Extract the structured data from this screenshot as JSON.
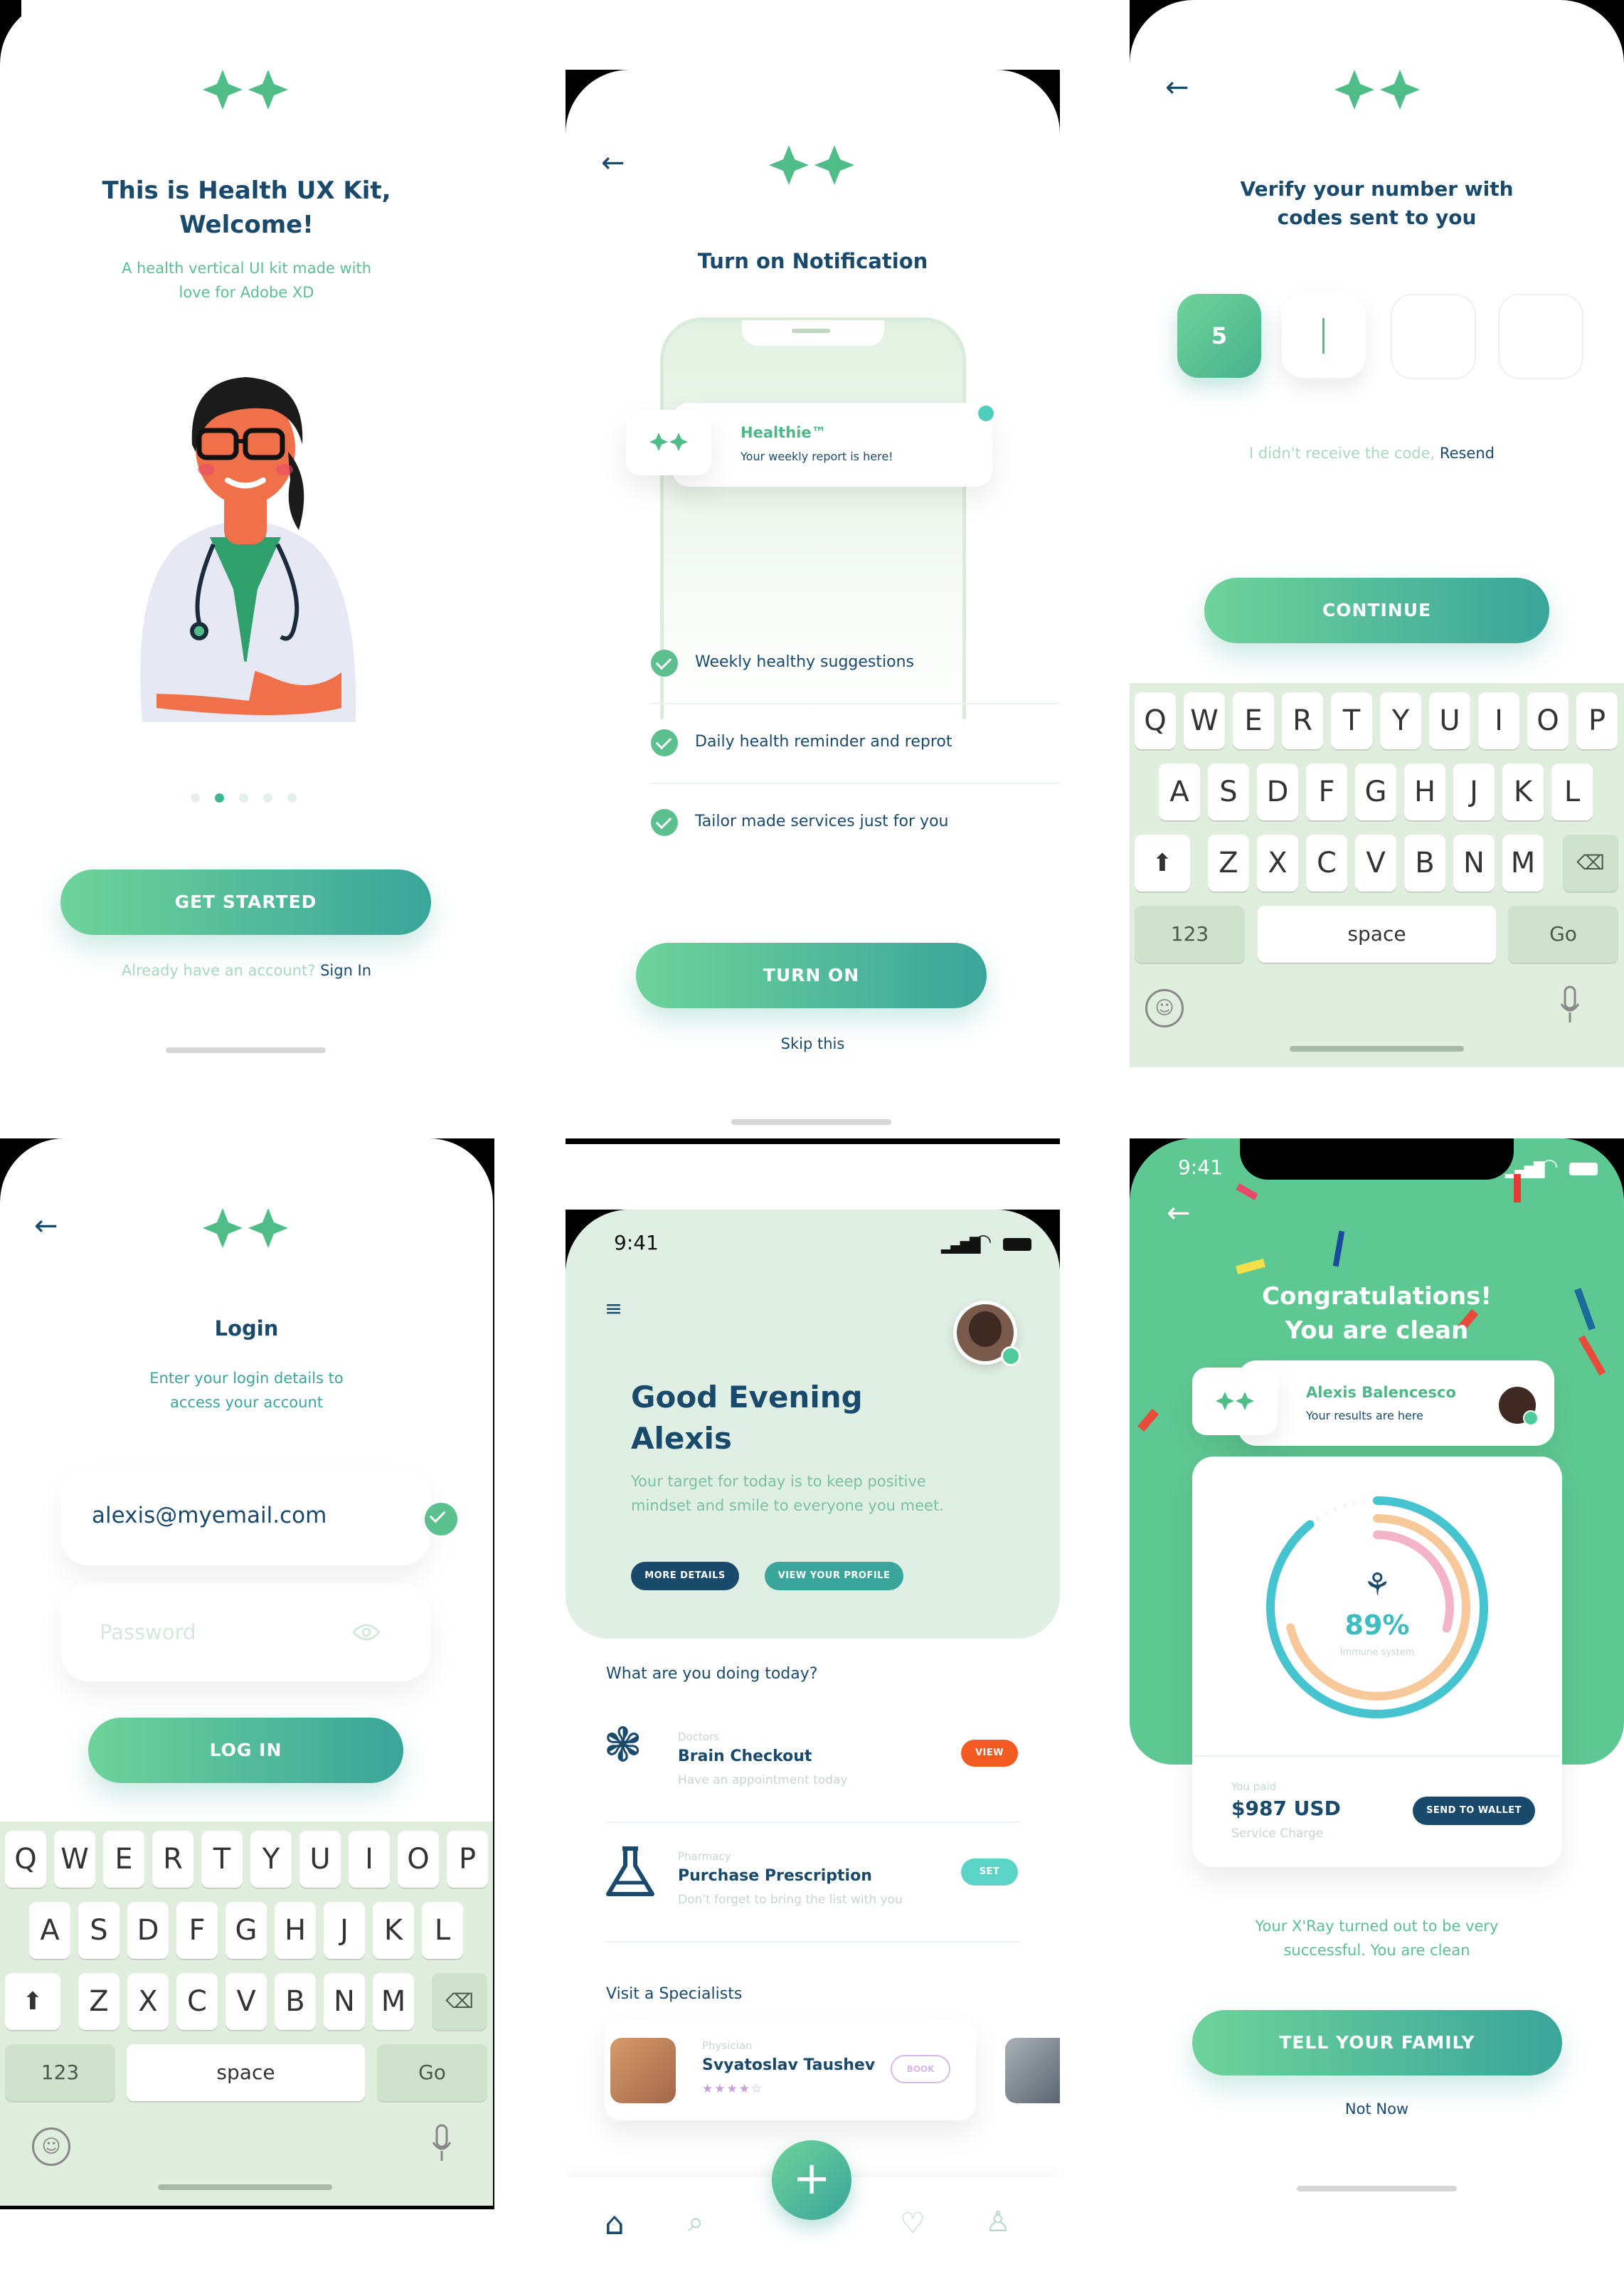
{
  "screen1": {
    "title": "This is Health UX Kit, Welcome!",
    "title_line1": "This is Health UX Kit,",
    "title_line2": "Welcome!",
    "subtitle_line1": "A health vertical UI kit made with",
    "subtitle_line2": "love for Adobe XD",
    "cta": "GET STARTED",
    "account_prompt": "Already have an account?",
    "sign_in": "Sign In"
  },
  "screen2": {
    "title": "Turn on Notification",
    "notif_app": "Healthie™",
    "notif_text": "Your weekly report is here!",
    "items": [
      "Weekly healthy suggestions",
      "Daily health reminder and reprot",
      "Tailor made services just for you"
    ],
    "cta": "TURN ON",
    "skip": "Skip this"
  },
  "screen3": {
    "title_line1": "Verify your number with",
    "title_line2": "codes sent to you",
    "code_digit": "5",
    "resend_prompt": "I didn't receive the code,",
    "resend": "Resend",
    "cta": "CONTINUE"
  },
  "keyboard": {
    "row1": [
      "Q",
      "W",
      "E",
      "R",
      "T",
      "Y",
      "U",
      "I",
      "O",
      "P"
    ],
    "row2": [
      "A",
      "S",
      "D",
      "F",
      "G",
      "H",
      "J",
      "K",
      "L"
    ],
    "row3": [
      "Z",
      "X",
      "C",
      "V",
      "B",
      "N",
      "M"
    ],
    "num": "123",
    "space": "space",
    "go": "Go"
  },
  "screen4": {
    "title": "Login",
    "subtitle_line1": "Enter your login details to",
    "subtitle_line2": "access your account",
    "email_value": "alexis@myemail.com",
    "password_placeholder": "Password",
    "cta": "LOG IN"
  },
  "screen5": {
    "time": "9:41",
    "greeting_line1": "Good Evening",
    "greeting_line2": "Alexis",
    "target_line1": "Your target for today is to keep positive",
    "target_line2": "mindset and smile to everyone you meet.",
    "btn_more": "MORE DETAILS",
    "btn_profile": "VIEW YOUR PROFILE",
    "question": "What are you doing today?",
    "tasks": [
      {
        "category": "Doctors",
        "title": "Brain Checkout",
        "desc": "Have an appointment today",
        "action": "VIEW",
        "color": "#f35a22"
      },
      {
        "category": "Pharmacy",
        "title": "Purchase Prescription",
        "desc": "Don't forget to bring the list with you",
        "action": "SET",
        "color": "#5bd3c6"
      }
    ],
    "specialists_label": "Visit a Specialists",
    "specialist": {
      "role": "Physician",
      "name": "Svyatoslav Taushev",
      "action": "BOOK",
      "rating": 4
    }
  },
  "screen6": {
    "time": "9:41",
    "title_line1": "Congratulations!",
    "title_line2": "You are clean",
    "patient_name": "Alexis Balencesco",
    "patient_note": "Your results are here",
    "percent": "89%",
    "percent_label": "Immune system",
    "paid_label": "You paid",
    "amount": "$987 USD",
    "charge_label": "Service Charge",
    "wallet_btn": "SEND TO WALLET",
    "result_line1": "Your X'Ray turned out to be very",
    "result_line2": "successful. You are clean",
    "cta": "TELL YOUR FAMILY",
    "not_now": "Not Now"
  },
  "colors": {
    "navy": "#1a4a6b",
    "green": "#5bbf93",
    "teal": "#3aa59a",
    "mint_bg": "#e0efe4",
    "congrats_bg": "#5ec892"
  }
}
